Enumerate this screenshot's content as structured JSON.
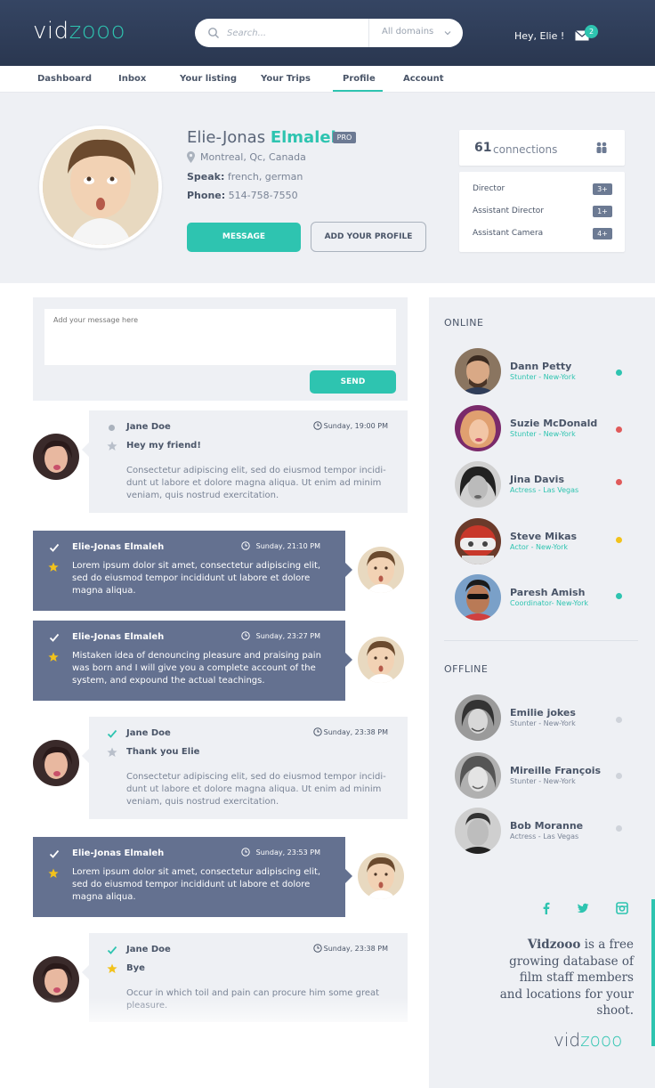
{
  "header": {
    "logo_prefix": "vid",
    "logo_accent": "zooo",
    "search_placeholder": "Search...",
    "domain_select": "All domains",
    "greeting": "Hey, Elie !",
    "mail_count": "2"
  },
  "nav": {
    "items": [
      "Dashboard",
      "Inbox",
      "Your listing",
      "Your Trips",
      "Profile",
      "Account"
    ],
    "active": "Profile"
  },
  "profile": {
    "first_name": "Elie-Jonas",
    "last_name": "Elmaleh",
    "badge": "PRO",
    "location": "Montreal, Qc, Canada",
    "speak_label": "Speak:",
    "speak_value": "french, german",
    "phone_label": "Phone:",
    "phone_value": "514-758-7550",
    "message_button": "MESSAGE",
    "add_button": "ADD YOUR PROFILE",
    "connections_count": "61",
    "connections_label": "connections",
    "roles": [
      {
        "label": "Director",
        "count": "3+"
      },
      {
        "label": "Assistant Director",
        "count": "1+"
      },
      {
        "label": "Assistant Camera",
        "count": "4+"
      }
    ]
  },
  "compose": {
    "placeholder": "Add your message here",
    "send_label": "SEND"
  },
  "messages": [
    {
      "author": "Jane Doe",
      "time": "Sunday, 19:00 PM",
      "subject": "Hey my friend!",
      "body": "Consectetur adipiscing elit, sed do eiusmod tempor incidi-dunt ut labore et dolore magna aliqua. Ut enim ad minim veniam, quis nostrud exercitation."
    },
    {
      "author": "Elie-Jonas Elmaleh",
      "time": "Sunday, 21:10 PM",
      "body": "Lorem ipsum dolor sit amet, consectetur adipiscing elit, sed do eiusmod tempor incididunt ut labore et dolore magna aliqua."
    },
    {
      "author": "Elie-Jonas Elmaleh",
      "time": "Sunday, 23:27 PM",
      "body": "Mistaken idea of denouncing pleasure and praising pain was born and I will give you a complete account of the system, and expound the actual teachings."
    },
    {
      "author": "Jane Doe",
      "time": "Sunday, 23:38 PM",
      "subject": "Thank you Elie",
      "body": "Consectetur adipiscing elit, sed do eiusmod tempor incidi-dunt ut labore et dolore magna aliqua. Ut enim ad minim veniam, quis nostrud exercitation."
    },
    {
      "author": "Elie-Jonas Elmaleh",
      "time": "Sunday, 23:53 PM",
      "body": "Lorem ipsum dolor sit amet, consectetur adipiscing elit, sed do eiusmod tempor incididunt ut labore et dolore magna aliqua."
    },
    {
      "author": "Jane Doe",
      "time": "Sunday, 23:38 PM",
      "subject": "Bye",
      "body": "Occur in which toil and pain can procure him some great pleasure."
    }
  ],
  "sidebar": {
    "online_heading": "ONLINE",
    "offline_heading": "OFFLINE",
    "online": [
      {
        "name": "Dann Petty",
        "role": "Stunter - New-York",
        "status_color": "#2ec4b0"
      },
      {
        "name": "Suzie McDonald",
        "role": "Stunter - New-York",
        "status_color": "#e05a5a"
      },
      {
        "name": "Jina Davis",
        "role": "Actress - Las Vegas",
        "status_color": "#e05a5a"
      },
      {
        "name": "Steve Mikas",
        "role": "Actor - New-York",
        "status_color": "#f2c21b"
      },
      {
        "name": "Paresh Amish",
        "role": "Coordinator- New-York",
        "status_color": "#2ec4b0"
      }
    ],
    "offline": [
      {
        "name": "Emilie jokes",
        "role": "Stunter - New-York"
      },
      {
        "name": "Mireille François",
        "role": "Stunter - New-York"
      },
      {
        "name": "Bob Moranne",
        "role": "Actress - Las Vegas"
      }
    ],
    "tagline_brand": "Vidzooo",
    "tagline_rest": " is a free growing database of film staff members and locations for your shoot.",
    "footer_logo_prefix": "vid",
    "footer_logo_accent": "zooo"
  },
  "colors": {
    "accent": "#2ec4b0",
    "header_bg": "#2f3d59",
    "outgoing_bubble": "#647190",
    "incoming_bubble": "#eef0f4"
  }
}
